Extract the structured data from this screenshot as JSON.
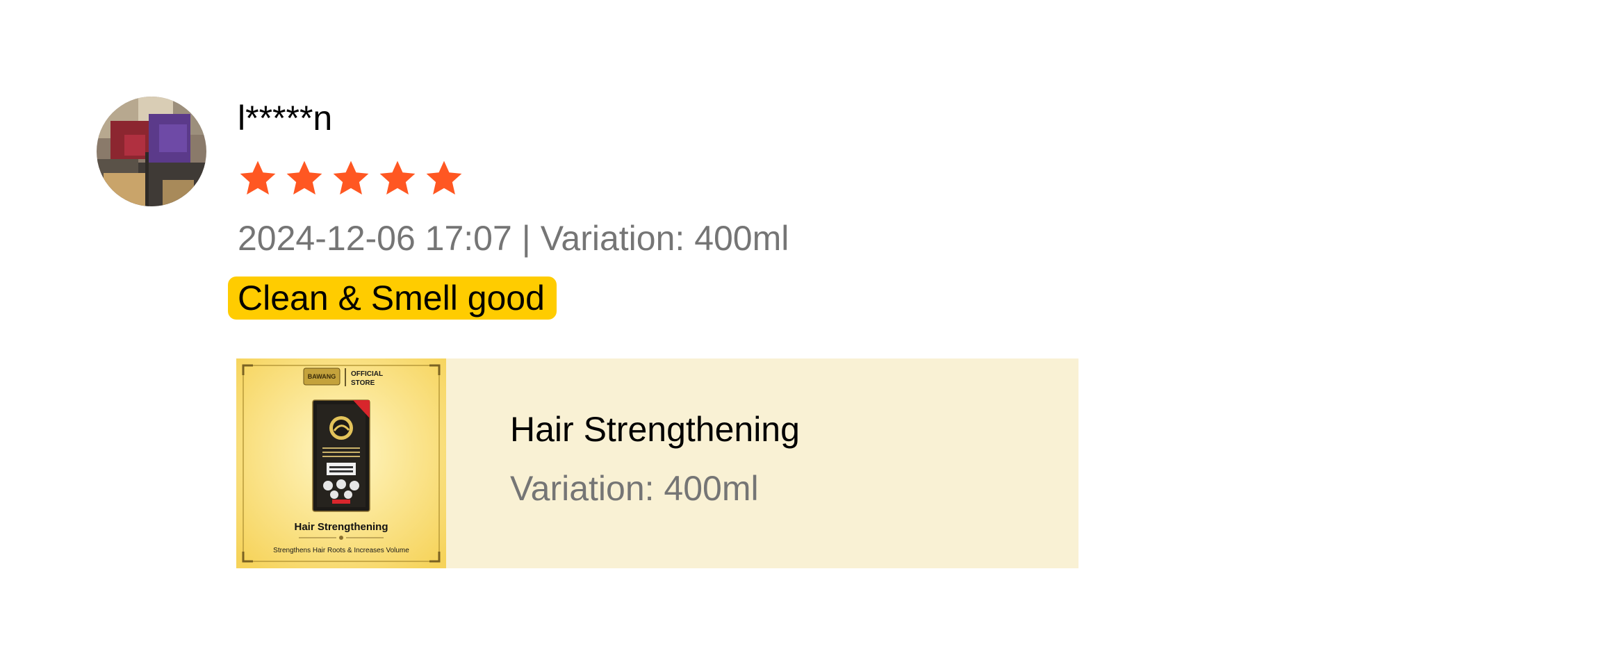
{
  "review": {
    "username": "l*****n",
    "rating": 5,
    "rating_max": 5,
    "star_color": "#ff5722",
    "date": "2024-12-06 17:07",
    "separator": "|",
    "variation": "Variation: 400ml",
    "tag": {
      "label": "Clean & Smell good",
      "color": "#ffcc00"
    }
  },
  "product": {
    "name": "Hair Strengthening",
    "variation": "Variation: 400ml",
    "card_color": "#f9f1d4",
    "thumbnail": {
      "brand": "BAWANG",
      "store_label_1": "OFFICIAL",
      "store_label_2": "STORE",
      "title": "Hair Strengthening",
      "subtitle": "Strengthens Hair Roots & Increases Volume"
    }
  }
}
